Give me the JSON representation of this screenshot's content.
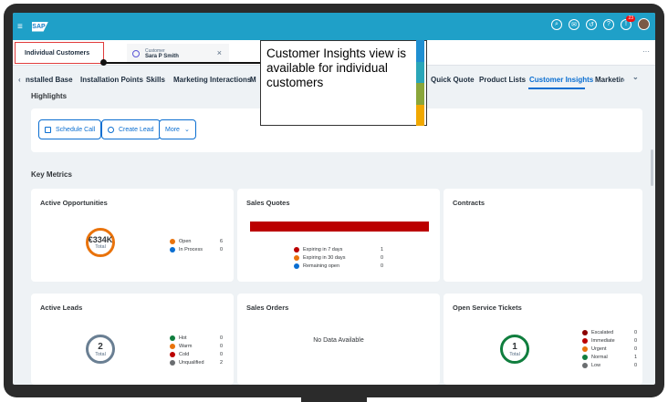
{
  "shell": {
    "logo": "SAP",
    "hamburger": "≡",
    "notifications_badge": "23",
    "icons": [
      "search-icon",
      "bell-icon",
      "history-icon",
      "help-icon",
      "notifications-icon",
      "user-avatar"
    ]
  },
  "tabs": {
    "individual_customers": "Individual Customers",
    "customer_kind": "Customer",
    "customer_name": "Sara P Smith",
    "close": "×",
    "more": "···"
  },
  "subnav": {
    "left_arrow": "‹",
    "items": [
      "nstalled Base",
      "Installation Points",
      "Skills",
      "Marketing Interactions",
      "M"
    ],
    "right_items": [
      "Quick Quote",
      "Product Lists",
      "Customer Insights",
      "Marketir"
    ],
    "active": "Customer Insights",
    "right_arrow": "›",
    "dropdown": "⌄"
  },
  "highlights": {
    "title": "Highlights",
    "buttons": [
      "Schedule Call",
      "Create Lead",
      "More"
    ],
    "more_chevron": "⌄"
  },
  "key_metrics": {
    "title": "Key Metrics",
    "active_opportunities": {
      "title": "Active Opportunities",
      "total_value": "€334K",
      "total_label": "Total",
      "legend": [
        {
          "label": "Open",
          "value": "6",
          "color": "#e9730c"
        },
        {
          "label": "In Process",
          "value": "0",
          "color": "#0a6ed1"
        }
      ]
    },
    "sales_quotes": {
      "title": "Sales Quotes",
      "legend": [
        {
          "label": "Expiring in 7 days",
          "value": "1",
          "color": "#bb0000"
        },
        {
          "label": "Expiring in 30 days",
          "value": "0",
          "color": "#e9730c"
        },
        {
          "label": "Remaining open",
          "value": "0",
          "color": "#0a6ed1"
        }
      ]
    },
    "contracts": {
      "title": "Contracts"
    },
    "active_leads": {
      "title": "Active Leads",
      "total_value": "2",
      "total_label": "Total",
      "legend": [
        {
          "label": "Hot",
          "value": "0",
          "color": "#107e3e"
        },
        {
          "label": "Warm",
          "value": "0",
          "color": "#e9730c"
        },
        {
          "label": "Cold",
          "value": "0",
          "color": "#bb0000"
        },
        {
          "label": "Unqualified",
          "value": "2",
          "color": "#6a6d70"
        }
      ]
    },
    "sales_orders": {
      "title": "Sales Orders",
      "empty": "No Data Available"
    },
    "open_service_tickets": {
      "title": "Open Service Tickets",
      "total_value": "1",
      "total_label": "Total",
      "legend": [
        {
          "label": "Escalated",
          "value": "0",
          "color": "#8b0000"
        },
        {
          "label": "Immediate",
          "value": "0",
          "color": "#bb0000"
        },
        {
          "label": "Urgent",
          "value": "0",
          "color": "#e9730c"
        },
        {
          "label": "Normal",
          "value": "1",
          "color": "#107e3e"
        },
        {
          "label": "Low",
          "value": "0",
          "color": "#6a6d70"
        }
      ]
    }
  },
  "callout": {
    "text": "Customer Insights view is available for individual customers",
    "stripe_colors": [
      "#1f8fd1",
      "#2aa6b8",
      "#8aa63a",
      "#f0a800"
    ]
  }
}
